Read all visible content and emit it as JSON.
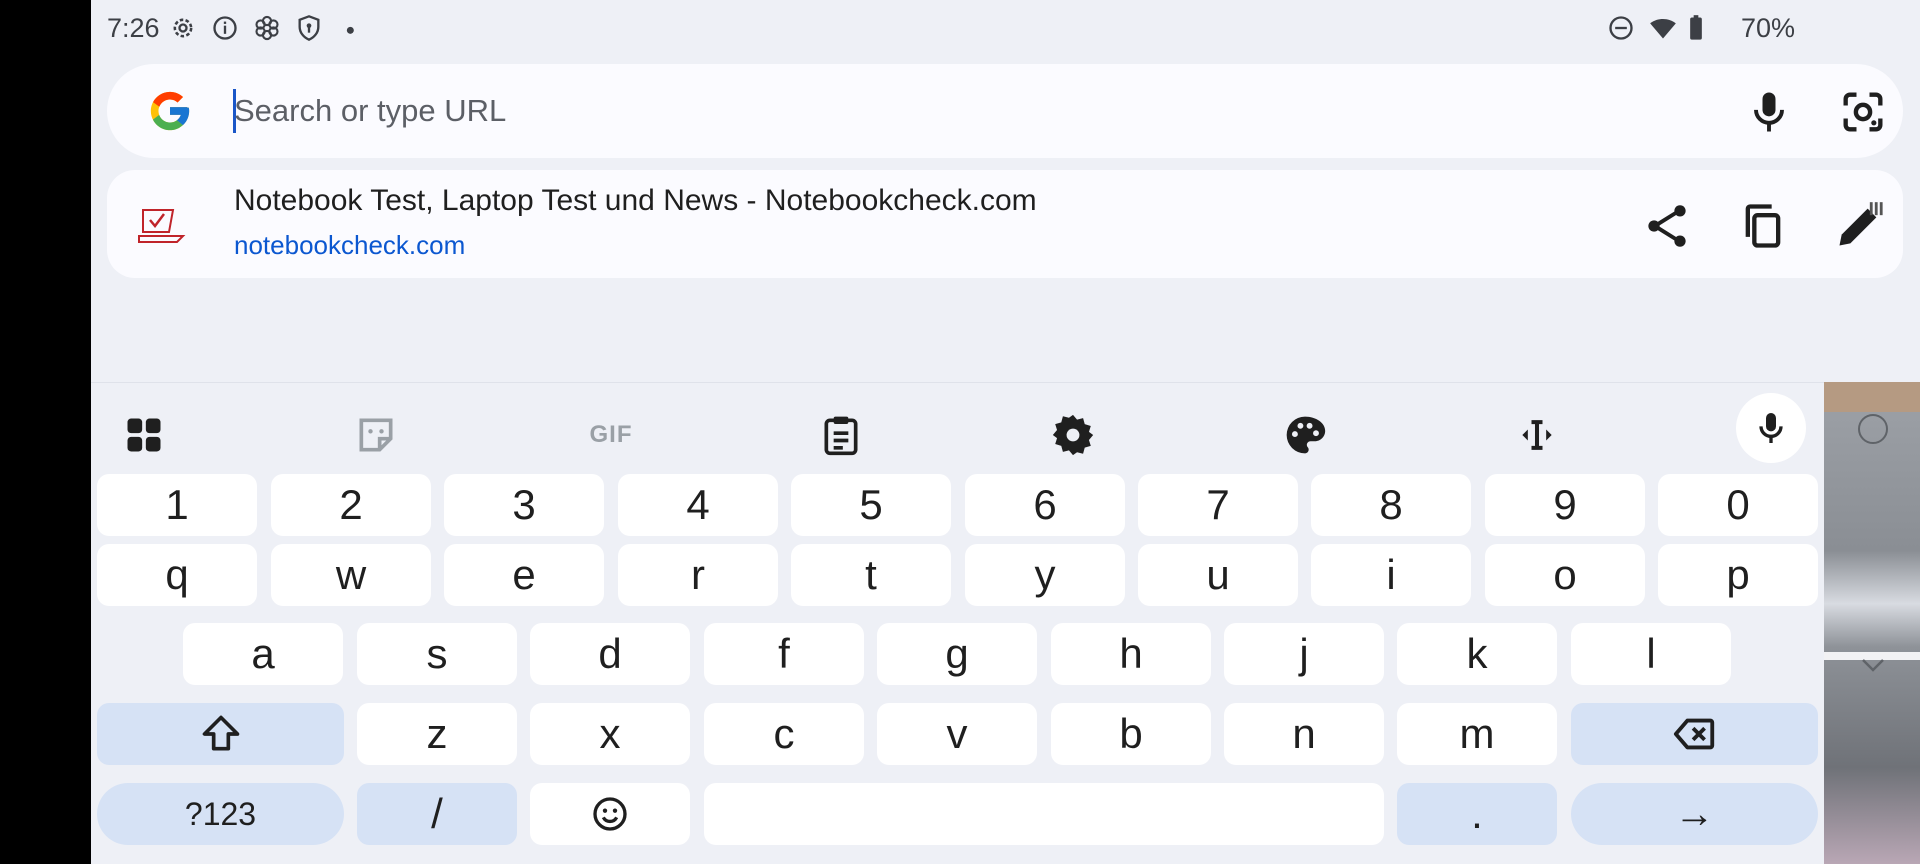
{
  "status_bar": {
    "time": "7:26",
    "battery": "70%",
    "left_icons": [
      "gear-icon",
      "info-icon",
      "flower-icon",
      "shield-icon",
      "dot-icon"
    ],
    "right_icons": [
      "do-not-disturb-icon",
      "wifi-icon",
      "battery-icon"
    ]
  },
  "search": {
    "placeholder": "Search or type URL",
    "value": ""
  },
  "suggestion": {
    "title": "Notebook Test, Laptop Test und News - Notebookcheck.com",
    "url": "notebookcheck.com"
  },
  "toolbar": {
    "items": [
      "apps-grid-icon",
      "sticker-icon",
      "gif-icon",
      "clipboard-icon",
      "settings-icon",
      "palette-icon",
      "text-cursor-icon",
      "mic-icon"
    ],
    "gif_label": "GIF"
  },
  "keyboard": {
    "row_numbers": [
      "1",
      "2",
      "3",
      "4",
      "5",
      "6",
      "7",
      "8",
      "9",
      "0"
    ],
    "row1": [
      "q",
      "w",
      "e",
      "r",
      "t",
      "y",
      "u",
      "i",
      "o",
      "p"
    ],
    "row2": [
      "a",
      "s",
      "d",
      "f",
      "g",
      "h",
      "j",
      "k",
      "l"
    ],
    "row3": [
      "z",
      "x",
      "c",
      "v",
      "b",
      "n",
      "m"
    ],
    "symbols_label": "?123",
    "slash_label": "/",
    "period_label": ".",
    "enter_label": "→"
  },
  "colors": {
    "accent": "#0b57d0",
    "function_key": "#d6e2f5",
    "background": "#eef0f6"
  }
}
